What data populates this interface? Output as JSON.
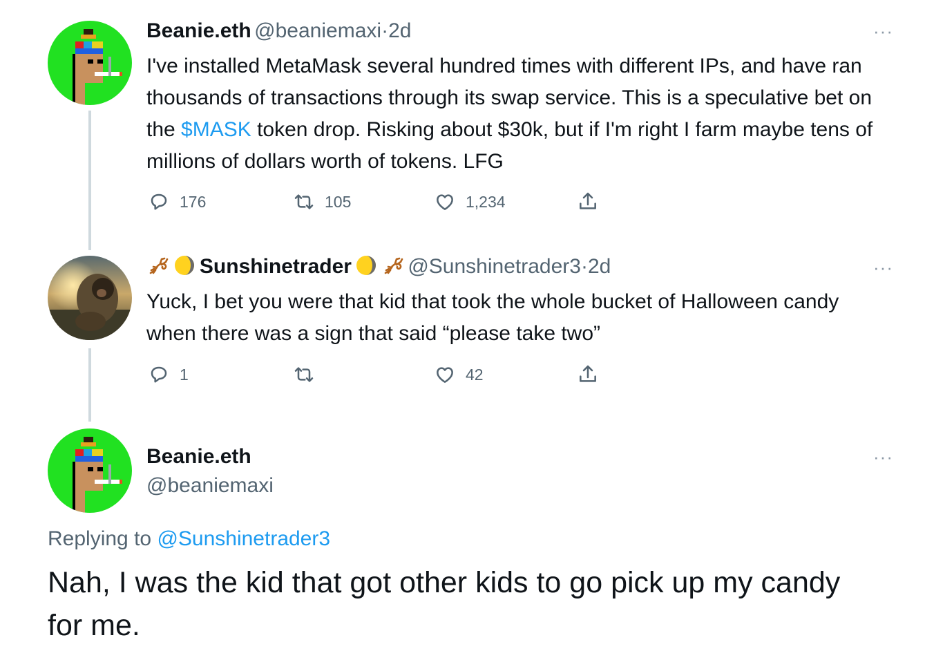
{
  "thread": [
    {
      "name": "Beanie.eth",
      "handle": "@beaniemaxi",
      "dot": "·",
      "time": "2d",
      "text_before_link": "I've installed MetaMask several hundred times with different IPs, and have ran thousands of transactions through its swap service. This is a speculative bet on the ",
      "link": "$MASK",
      "text_after_link": " token drop. Risking about $30k, but if I'm right I farm maybe tens of millions of dollars worth of tokens. LFG",
      "more": "···",
      "replies": "176",
      "retweets": "105",
      "likes": "1,234"
    },
    {
      "name": "Sunshinetrader",
      "handle": "@Sunshinetrader3",
      "dot": "·",
      "time": "2d",
      "text": "Yuck, I bet you were that kid that took the whole bucket of Halloween candy when there was a sign that said “please take two”",
      "more": "···",
      "replies": "1",
      "retweets": "",
      "likes": "42"
    }
  ],
  "main": {
    "name": "Beanie.eth",
    "handle": "@beaniemaxi",
    "more": "···",
    "replying_prefix": "Replying to ",
    "replying_to": "@Sunshinetrader3",
    "text": "Nah, I was the kid that got other kids to go pick up my candy for me."
  },
  "colors": {
    "link": "#1d9bf0",
    "secondary": "#536471",
    "avatar_green": "#21e121",
    "thread_line": "#cfd9de"
  }
}
